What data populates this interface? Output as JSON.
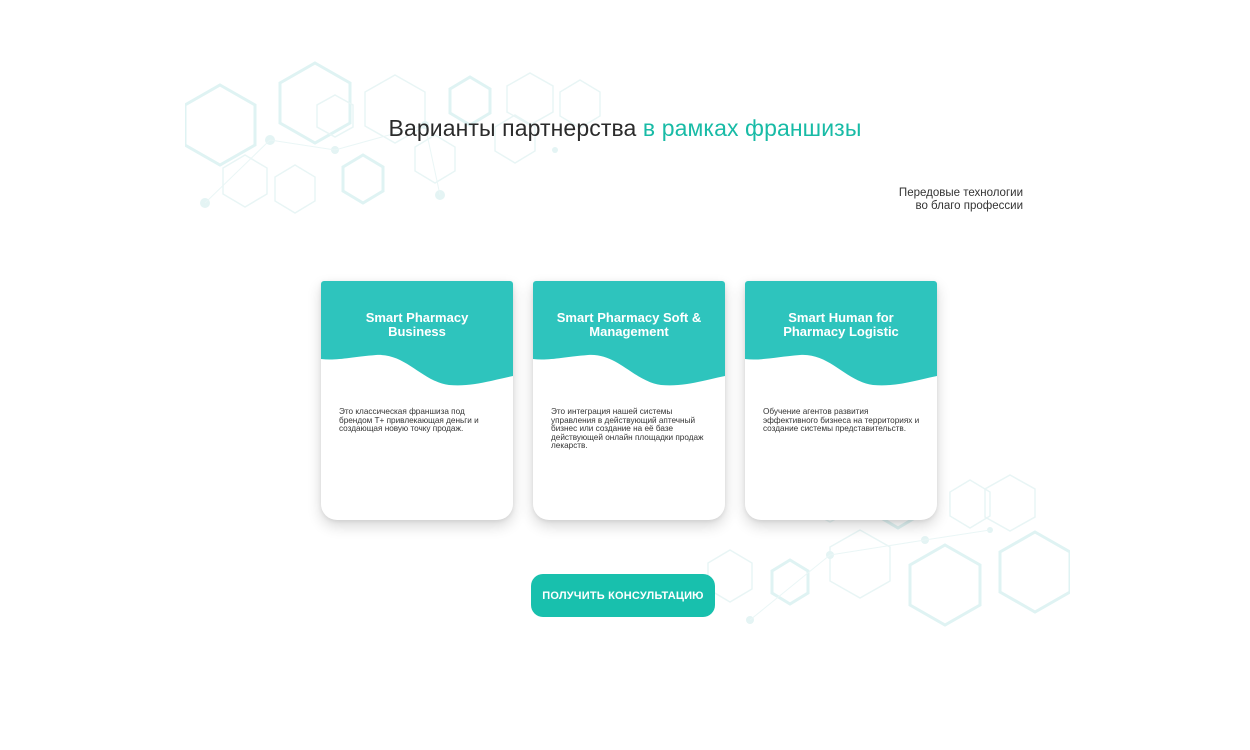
{
  "heading": {
    "main": "Варианты партнерства ",
    "accent": "в рамках франшизы"
  },
  "tagline": {
    "line1": "Передовые технологии",
    "line2": "во благо профессии"
  },
  "cards": [
    {
      "title_line1": "Smart Pharmacy",
      "title_line2": "Business",
      "text": "Это классическая франшиза под брендом Т+ привлекающая деньги и создающая новую точку продаж."
    },
    {
      "title_line1": "Smart Pharmacy Soft &",
      "title_line2": "Management",
      "text": "Это интеграция нашей системы управления в действующий аптечный бизнес или создание на её базе действующей онлайн площадки продаж лекарств."
    },
    {
      "title_line1": "Smart Human for",
      "title_line2": "Pharmacy Logistic",
      "text": "Обучение агентов развития эффективного бизнеса на территориях и создание системы представительств."
    }
  ],
  "cta": {
    "label": "ПОЛУЧИТЬ КОНСУЛЬТАЦИЮ"
  },
  "colors": {
    "accent": "#18bba6",
    "card_header": "#2ec4bd",
    "button": "#18c0ad",
    "decor": "#dff3f3"
  },
  "icons": {
    "background_top": "hexagon-molecule-pattern",
    "background_bottom": "hexagon-molecule-pattern"
  }
}
